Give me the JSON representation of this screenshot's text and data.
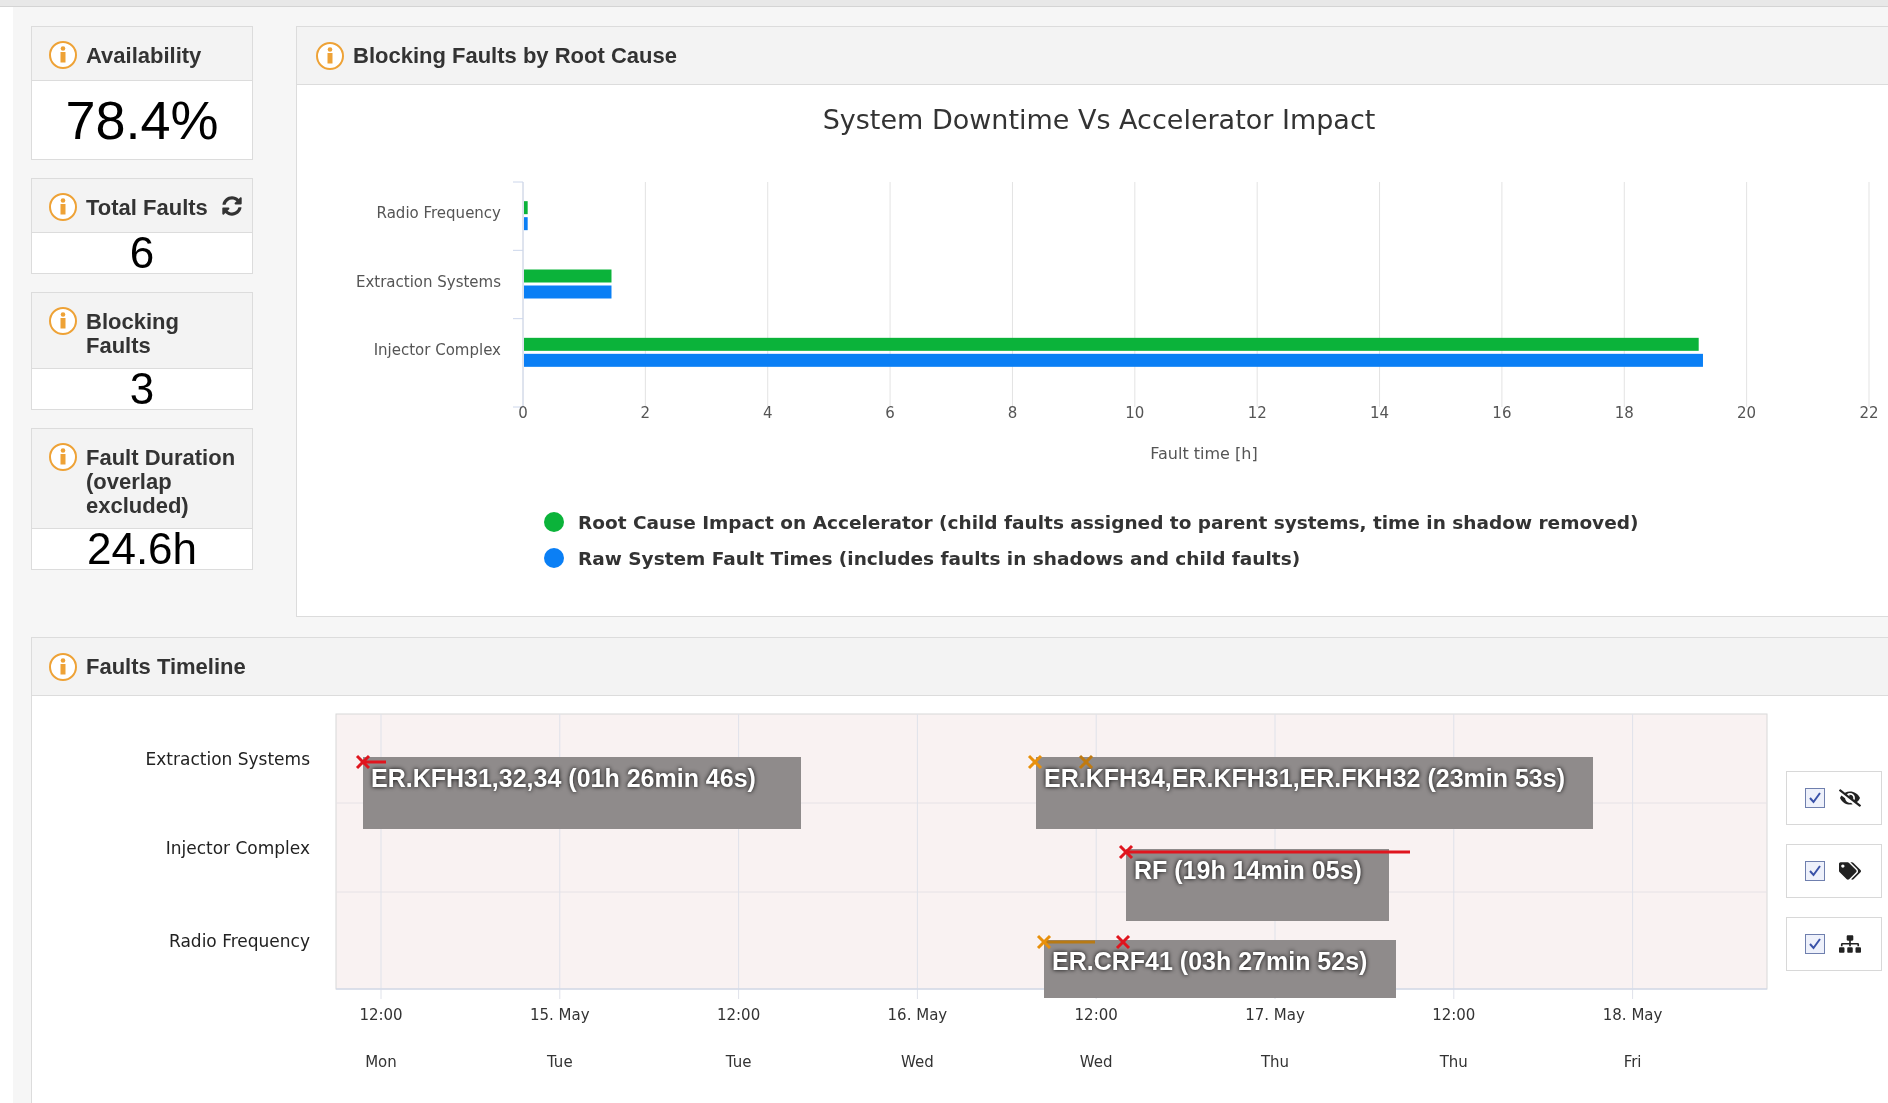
{
  "stat_cards": [
    {
      "title": "Availability",
      "value": "78.4%",
      "has_refresh": false
    },
    {
      "title": "Total Faults",
      "value": "6",
      "has_refresh": true
    },
    {
      "title": "Blocking Faults",
      "value": "3",
      "has_refresh": false
    },
    {
      "title": "Fault Duration (overlap excluded)",
      "value": "24.6h",
      "has_refresh": false
    }
  ],
  "root_cause_panel": {
    "title": "Blocking Faults by Root Cause",
    "chart_data": {
      "type": "bar",
      "orientation": "horizontal",
      "title": "System Downtime Vs Accelerator Impact",
      "xlabel": "Fault time [h]",
      "categories": [
        "Radio Frequency",
        "Extraction Systems",
        "Injector Complex"
      ],
      "series": [
        {
          "name": "Root Cause Impact on Accelerator (child faults assigned to parent systems, time in shadow removed)",
          "color": "#0bb33a",
          "values": [
            0.06,
            1.43,
            19.2
          ]
        },
        {
          "name": "Raw System Fault Times (includes faults in shadows and child faults)",
          "color": "#0a7ff5",
          "values": [
            0.06,
            1.43,
            19.27
          ]
        }
      ],
      "xlim": [
        0,
        22
      ],
      "xticks": [
        0,
        2,
        4,
        6,
        8,
        10,
        12,
        14,
        16,
        18,
        20,
        22
      ],
      "grid": true,
      "legend": true
    }
  },
  "timeline_panel": {
    "title": "Faults Timeline",
    "rows": [
      "Extraction Systems",
      "Injector Complex",
      "Radio Frequency"
    ],
    "axis_ticks": [
      {
        "time": "12:00",
        "day": "Mon"
      },
      {
        "time": "15. May",
        "day": "Tue"
      },
      {
        "time": "12:00",
        "day": "Tue"
      },
      {
        "time": "16. May",
        "day": "Wed"
      },
      {
        "time": "12:00",
        "day": "Wed"
      },
      {
        "time": "17. May",
        "day": "Thu"
      },
      {
        "time": "12:00",
        "day": "Thu"
      },
      {
        "time": "18. May",
        "day": "Fri"
      }
    ],
    "events": [
      {
        "label": "ER.KFH31,32,34 (01h 26min 46s)",
        "markers": [
          {
            "color": "#e0151e"
          }
        ]
      },
      {
        "label": "ER.KFH34,ER.KFH31,ER.FKH32 (23min 53s)",
        "markers": [
          {
            "color": "#e8900c"
          },
          {
            "color": "#c07a10"
          }
        ]
      },
      {
        "label": "RF (19h 14min 05s)",
        "markers": [
          {
            "color": "#e0151e"
          }
        ]
      },
      {
        "label": "ER.CRF41 (03h 27min 52s)",
        "markers": [
          {
            "color": "#e8900c"
          },
          {
            "color": "#e0151e"
          }
        ]
      }
    ],
    "controls": [
      {
        "kind": "visibility",
        "checked": true
      },
      {
        "kind": "labels",
        "checked": true
      },
      {
        "kind": "hierarchy",
        "checked": true
      }
    ]
  }
}
